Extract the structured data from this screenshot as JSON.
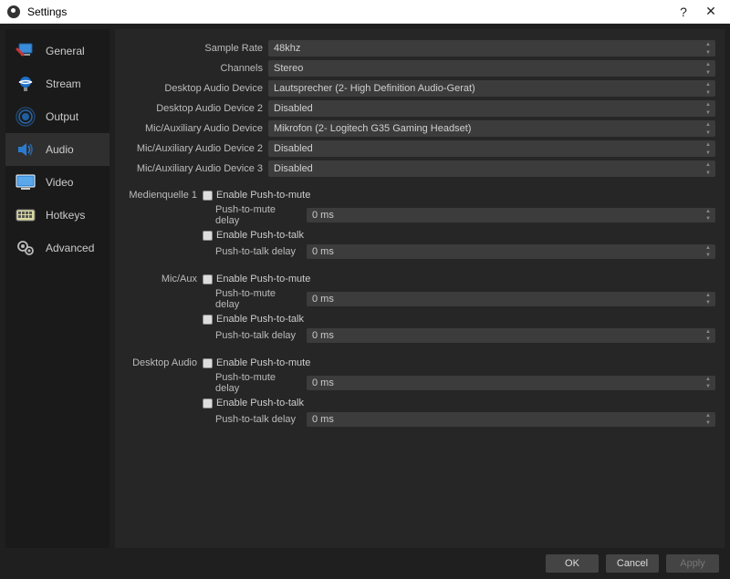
{
  "window": {
    "title": "Settings",
    "help": "?",
    "close": "✕"
  },
  "sidebar": {
    "items": [
      {
        "label": "General"
      },
      {
        "label": "Stream"
      },
      {
        "label": "Output"
      },
      {
        "label": "Audio"
      },
      {
        "label": "Video"
      },
      {
        "label": "Hotkeys"
      },
      {
        "label": "Advanced"
      }
    ]
  },
  "audio": {
    "fields": [
      {
        "label": "Sample Rate",
        "value": "48khz"
      },
      {
        "label": "Channels",
        "value": "Stereo"
      },
      {
        "label": "Desktop Audio Device",
        "value": "Lautsprecher (2- High Definition Audio-Gerat)"
      },
      {
        "label": "Desktop Audio Device 2",
        "value": "Disabled"
      },
      {
        "label": "Mic/Auxiliary Audio Device",
        "value": "Mikrofon (2- Logitech G35 Gaming Headset)"
      },
      {
        "label": "Mic/Auxiliary Audio Device 2",
        "value": "Disabled"
      },
      {
        "label": "Mic/Auxiliary Audio Device 3",
        "value": "Disabled"
      }
    ],
    "sections": [
      {
        "name": "Medienquelle 1",
        "enable_ptm": "Enable Push-to-mute",
        "ptm_delay_label": "Push-to-mute delay",
        "ptm_delay_value": "0 ms",
        "enable_ptt": "Enable Push-to-talk",
        "ptt_delay_label": "Push-to-talk delay",
        "ptt_delay_value": "0 ms"
      },
      {
        "name": "Mic/Aux",
        "enable_ptm": "Enable Push-to-mute",
        "ptm_delay_label": "Push-to-mute delay",
        "ptm_delay_value": "0 ms",
        "enable_ptt": "Enable Push-to-talk",
        "ptt_delay_label": "Push-to-talk delay",
        "ptt_delay_value": "0 ms"
      },
      {
        "name": "Desktop Audio",
        "enable_ptm": "Enable Push-to-mute",
        "ptm_delay_label": "Push-to-mute delay",
        "ptm_delay_value": "0 ms",
        "enable_ptt": "Enable Push-to-talk",
        "ptt_delay_label": "Push-to-talk delay",
        "ptt_delay_value": "0 ms"
      }
    ]
  },
  "footer": {
    "ok": "OK",
    "cancel": "Cancel",
    "apply": "Apply"
  }
}
